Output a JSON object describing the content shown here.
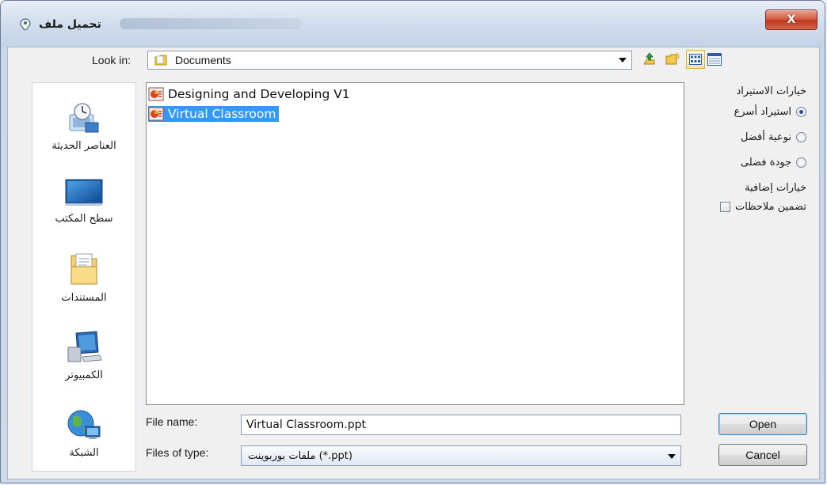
{
  "window": {
    "title": "تحميل ملف",
    "close_label": "X"
  },
  "lookin": {
    "label": "Look in:",
    "value": "Documents"
  },
  "toolbar": {
    "icons": [
      "up-folder-icon",
      "new-folder-icon",
      "list-view-icon",
      "details-view-icon"
    ]
  },
  "places": {
    "items": [
      {
        "label": "العناصر الحديثة",
        "icon": "recent-items-icon"
      },
      {
        "label": "سطح المكتب",
        "icon": "desktop-icon"
      },
      {
        "label": "المستندات",
        "icon": "documents-icon"
      },
      {
        "label": "الكمبيوتر",
        "icon": "computer-icon"
      },
      {
        "label": "الشبكة",
        "icon": "network-icon"
      }
    ]
  },
  "files": {
    "items": [
      {
        "name": "Designing and Developing V1",
        "selected": false
      },
      {
        "name": "Virtual Classroom",
        "selected": true
      }
    ]
  },
  "options": {
    "import_heading": "خيارات الاستيراد",
    "radios": [
      {
        "label": "استيراد أسرع",
        "checked": true
      },
      {
        "label": "نوعية أفضل",
        "checked": false
      },
      {
        "label": "جودة فضلى",
        "checked": false
      }
    ],
    "extra_heading": "خيارات إضافية",
    "include_notes_label": "تضمين ملاحظات",
    "include_notes_checked": false
  },
  "filename": {
    "label": "File name:",
    "value": "Virtual Classroom.ppt"
  },
  "filetype": {
    "label": "Files of type:",
    "value": "ملفات بوربوينت (*.ppt)"
  },
  "buttons": {
    "open": "Open",
    "cancel": "Cancel"
  },
  "colors": {
    "selection": "#3399ff",
    "close_button": "#c0391f"
  }
}
